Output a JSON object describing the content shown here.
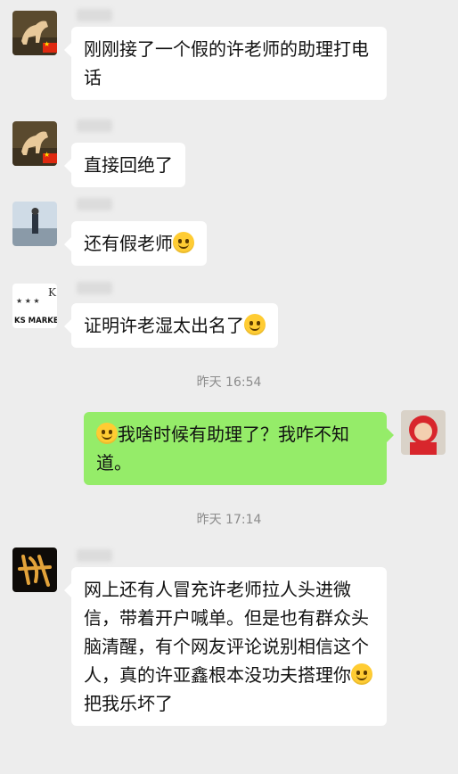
{
  "messages": [
    {
      "id": "m1",
      "side": "left",
      "avatar": "horse-avatar",
      "text": "刚刚接了一个假的许老师的助理打电话",
      "emoji": ""
    },
    {
      "id": "m2",
      "side": "left",
      "avatar": "horse-avatar",
      "text": "直接回绝了",
      "emoji": ""
    },
    {
      "id": "m3",
      "side": "left",
      "avatar": "man-seaside-avatar",
      "text": "还有假老师",
      "emoji": "laughing-crying-emoji"
    },
    {
      "id": "m4",
      "side": "left",
      "avatar": "ks-market-avatar",
      "text": "证明许老湿太出名了",
      "emoji": "smiling-emoji"
    },
    {
      "id": "m5",
      "side": "right",
      "avatar": "child-red-hood-avatar",
      "text": "我啥时候有助理了？我咋不知道。",
      "emoji": "medal-emoji"
    },
    {
      "id": "m6",
      "side": "left",
      "avatar": "calligraphy-avatar",
      "text": "网上还有人冒充许老师拉人头进微信，带着开户喊单。但是也有群众头脑清醒，有个网友评论说别相信这个人，真的许亚鑫根本没功夫搭理你",
      "emoji": "grinning-emoji",
      "tail": "把我乐坏了"
    }
  ],
  "timestamps": {
    "t1": "昨天 16:54",
    "t2": "昨天 17:14"
  },
  "avatar_labels": {
    "ks_market": "KS MARKET"
  },
  "colors": {
    "background": "#ededed",
    "incoming_bubble": "#ffffff",
    "outgoing_bubble": "#95ec69",
    "timestamp": "#8c8c8c"
  }
}
